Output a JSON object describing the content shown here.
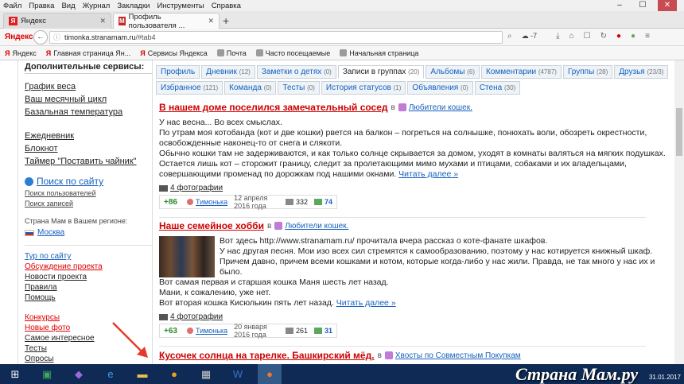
{
  "menu": [
    "Файл",
    "Правка",
    "Вид",
    "Журнал",
    "Закладки",
    "Инструменты",
    "Справка"
  ],
  "window_buttons": [
    "–",
    "☐",
    "✕"
  ],
  "tabs": [
    {
      "label": "Яндекс",
      "icon": "yandex-icon",
      "color": "#e02020"
    },
    {
      "label": "Профиль пользователя ...",
      "icon": "stranamam-icon",
      "color": "#c62828"
    }
  ],
  "tab_close": "✕",
  "new_tab": "+",
  "nav": {
    "brand": "Яндекс",
    "back": "←",
    "url_host": "timonka.stranamam.ru",
    "url_path": "/#tab4",
    "weather": "-7"
  },
  "bookmarks": [
    {
      "label": "Яндекс",
      "icon": "Я"
    },
    {
      "label": "Главная страница Ян...",
      "icon": "Я"
    },
    {
      "label": "Сервисы Яндекса",
      "icon": "Я"
    },
    {
      "label": "Почта",
      "icon": ""
    },
    {
      "label": "Часто посещаемые",
      "icon": ""
    },
    {
      "label": "Начальная страница",
      "icon": ""
    }
  ],
  "sidebar": {
    "services_title": "Дополнительные сервисы:",
    "services": [
      "График веса",
      "Ваш месячный цикл",
      "Базальная температура"
    ],
    "tools": [
      "Ежедневник",
      "Блокнот",
      "Таймер \"Поставить чайник\""
    ],
    "search_label": "Поиск по сайту",
    "search_links": [
      "Поиск пользователей",
      "Поиск записей"
    ],
    "region_label": "Страна Мам в Вашем регионе:",
    "region_city": "Москва",
    "project_links": [
      {
        "label": "Тур по сайту",
        "style": "blue"
      },
      {
        "label": "Обсуждение проекта",
        "style": "red"
      },
      {
        "label": "Новости проекта",
        "style": "plain"
      },
      {
        "label": "Правила",
        "style": "plain"
      },
      {
        "label": "Помощь",
        "style": "plain"
      }
    ],
    "extra_links": [
      {
        "label": "Конкурсы",
        "style": "red"
      },
      {
        "label": "Новые фото",
        "style": "red"
      },
      {
        "label": "Самое интересное",
        "style": "plain"
      },
      {
        "label": "Тесты",
        "style": "plain"
      },
      {
        "label": "Опросы",
        "style": "plain"
      }
    ]
  },
  "profile_tabs_row1": [
    {
      "label": "Профиль",
      "count": ""
    },
    {
      "label": "Дневник",
      "count": "(12)"
    },
    {
      "label": "Заметки о детях",
      "count": "(0)"
    },
    {
      "label": "Записи в группах",
      "count": "(20)",
      "active": true
    },
    {
      "label": "Альбомы",
      "count": "(6)"
    },
    {
      "label": "Комментарии",
      "count": "(4787)"
    },
    {
      "label": "Группы",
      "count": "(28)"
    },
    {
      "label": "Друзья",
      "count": "(23/3)"
    }
  ],
  "profile_tabs_row2": [
    {
      "label": "Избранное",
      "count": "(121)"
    },
    {
      "label": "Команда",
      "count": "(0)"
    },
    {
      "label": "Тесты",
      "count": "(0)"
    },
    {
      "label": "История статусов",
      "count": "(1)"
    },
    {
      "label": "Объявления",
      "count": "(0)"
    },
    {
      "label": "Стена",
      "count": "(30)"
    }
  ],
  "posts": [
    {
      "title": "В нашем доме поселился замечательный сосед",
      "in": "в",
      "group": "Любители кошек.",
      "lines": [
        "У нас весна... Во всех смыслах.",
        "По утрам моя котобанда (кот и две кошки) рвется на балкон – погреться на солнышке, понюхать воли, обозреть окрестности,",
        "освобожденные наконец-то от снега и слякоти.",
        "Обычно кошки там не задерживаются, и как только солнце скрывается за домом, уходят в комнаты валяться на мягких подушках.",
        "Остается лишь кот – сторожит границу, следит за пролетающими мимо мухами и птицами, собаками и их владельцами,",
        "совершающими променад по дорожкам под нашими окнами."
      ],
      "more": "Читать далее »",
      "photos": "4 фотографии",
      "score": "+86",
      "user": "Тимонька",
      "date": "12 апреля 2016 года",
      "views": "332",
      "shares": "74"
    },
    {
      "title": "Наше семейное хобби",
      "in": "в",
      "group": "Любители кошек.",
      "lines": [
        "Вот здесь http://www.stranamam.ru/ прочитала вчера рассказ о коте-фанате шкафов.",
        "У нас другая песня. Мои изо всех сил стремятся к самообразованию, поэтому у нас котируется книжный шкаф.",
        "Причем давно, причем всеми кошками и котом, которые когда-либо у нас жили. Правда, не так много у нас их и",
        "было.",
        "Вот самая первая и старшая кошка Маня шесть лет назад.",
        "Мани, к сожалению, уже нет.",
        "Вот вторая кошка Кисюлькин пять лет назад."
      ],
      "more": "Читать далее »",
      "photos": "4 фотографии",
      "score": "+63",
      "user": "Тимонька",
      "date": "20 января 2016 года",
      "views": "261",
      "shares": "31"
    },
    {
      "title": "Кусочек солнца на тарелке. Башкирский мёд.",
      "in": "в",
      "group": "Хвосты по Совместным Покупкам"
    }
  ],
  "taskbar_logo": "Страна Мам.ру",
  "clock": "31.01.2017"
}
